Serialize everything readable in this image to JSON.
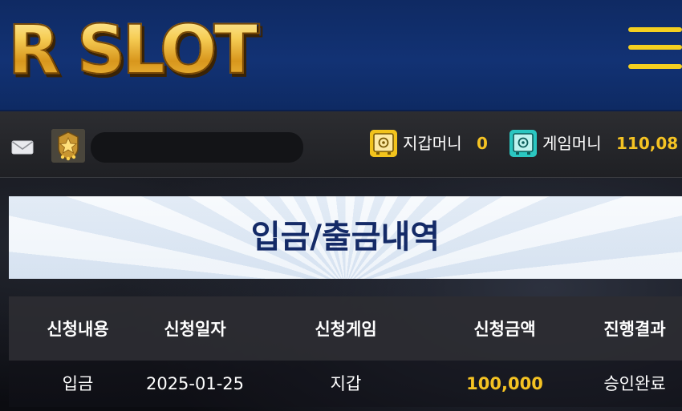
{
  "header": {
    "logo_text": "R SLOT",
    "menu_icon": "hamburger-menu-icon",
    "colors": {
      "header_bg": "#123274",
      "logo_gold": "#f3c245",
      "menu_yellow": "#f4cf20"
    }
  },
  "userbar": {
    "mail_icon": "envelope-icon",
    "rank_icon": "rank-badge-icon",
    "username": "",
    "wallet": {
      "icon": "wallet-safe-icon",
      "label": "지갑머니",
      "value": "0"
    },
    "game": {
      "icon": "game-safe-icon",
      "label": "게임머니",
      "value": "110,08"
    },
    "colors": {
      "value_yellow": "#f5c323",
      "wallet_icon": "#f2c31c",
      "game_icon": "#2bc7c1"
    }
  },
  "page": {
    "title": "입금/출금내역"
  },
  "table": {
    "columns": [
      "신청내용",
      "신청일자",
      "신청게임",
      "신청금액",
      "진행결과"
    ],
    "rows": [
      {
        "type": "입금",
        "date": "2025-01-25",
        "game": "지갑",
        "amount": "100,000",
        "status": "승인완료"
      }
    ]
  }
}
